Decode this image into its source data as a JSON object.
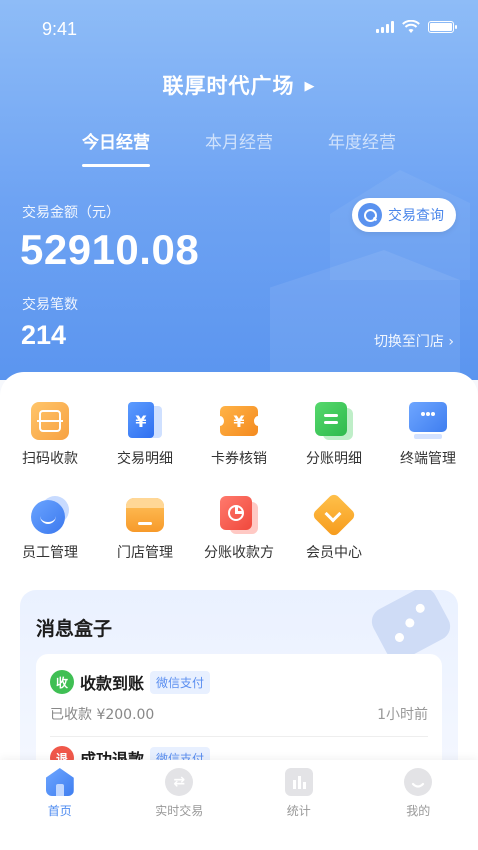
{
  "status_bar": {
    "time": "9:41"
  },
  "header": {
    "store_name": "联厚时代广场",
    "store_arrow": "▶"
  },
  "tabs": [
    {
      "label": "今日经营",
      "active": true
    },
    {
      "label": "本月经营",
      "active": false
    },
    {
      "label": "年度经营",
      "active": false
    }
  ],
  "summary": {
    "amount_label": "交易金额（元）",
    "amount": "52910.08",
    "count_label": "交易笔数",
    "count": "214",
    "query_button": "交易查询",
    "switch_store": "切换至门店 ›"
  },
  "menu": [
    {
      "label": "扫码收款",
      "icon": "scan-icon",
      "glyph": ""
    },
    {
      "label": "交易明细",
      "icon": "transaction-icon",
      "glyph": "¥"
    },
    {
      "label": "卡券核销",
      "icon": "coupon-icon",
      "glyph": "¥"
    },
    {
      "label": "分账明细",
      "icon": "split-detail-icon",
      "glyph": ""
    },
    {
      "label": "终端管理",
      "icon": "terminal-icon",
      "glyph": ""
    },
    {
      "label": "员工管理",
      "icon": "staff-icon",
      "glyph": ""
    },
    {
      "label": "门店管理",
      "icon": "store-icon",
      "glyph": ""
    },
    {
      "label": "分账收款方",
      "icon": "split-receiver-icon",
      "glyph": ""
    },
    {
      "label": "会员中心",
      "icon": "member-icon",
      "glyph": ""
    }
  ],
  "messages": {
    "title": "消息盒子",
    "items": [
      {
        "badge": "收",
        "title": "收款到账",
        "tag": "微信支付",
        "detail": "已收款 ¥200.00",
        "time": "1小时前"
      },
      {
        "badge": "退",
        "title": "成功退款",
        "tag": "微信支付"
      }
    ]
  },
  "nav": [
    {
      "label": "首页",
      "icon": "home-icon",
      "active": true
    },
    {
      "label": "实时交易",
      "icon": "exchange-icon",
      "active": false
    },
    {
      "label": "统计",
      "icon": "chart-icon",
      "active": false
    },
    {
      "label": "我的",
      "icon": "profile-icon",
      "active": false
    }
  ],
  "colors": {
    "primary": "#4f8cf0",
    "header_gradient_top": "#8ebcf7",
    "header_gradient_bottom": "#5b95ef"
  }
}
